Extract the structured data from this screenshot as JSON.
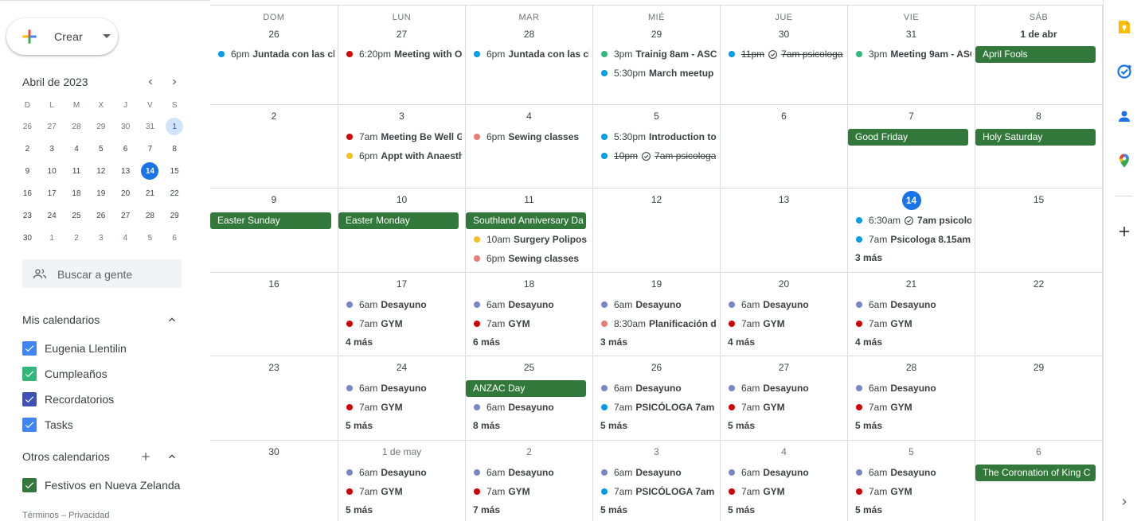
{
  "create": {
    "label": "Crear"
  },
  "mini_calendar": {
    "title": "Abril de 2023",
    "weekdays": [
      "D",
      "L",
      "M",
      "X",
      "J",
      "V",
      "S"
    ],
    "weeks": [
      [
        "26",
        "27",
        "28",
        "29",
        "30",
        "31",
        "1"
      ],
      [
        "2",
        "3",
        "4",
        "5",
        "6",
        "7",
        "8"
      ],
      [
        "9",
        "10",
        "11",
        "12",
        "13",
        "14",
        "15"
      ],
      [
        "16",
        "17",
        "18",
        "19",
        "20",
        "21",
        "22"
      ],
      [
        "23",
        "24",
        "25",
        "26",
        "27",
        "28",
        "29"
      ],
      [
        "30",
        "1",
        "2",
        "3",
        "4",
        "5",
        "6"
      ]
    ]
  },
  "search_people": {
    "placeholder": "Buscar a gente"
  },
  "my_calendars": {
    "title": "Mis calendarios",
    "items": [
      {
        "label": "Eugenia Llentilin",
        "color": "#4285f4"
      },
      {
        "label": "Cumpleaños",
        "color": "#33b679"
      },
      {
        "label": "Recordatorios",
        "color": "#3f51b5"
      },
      {
        "label": "Tasks",
        "color": "#4285f4"
      }
    ]
  },
  "other_calendars": {
    "title": "Otros calendarios",
    "items": [
      {
        "label": "Festivos en Nueva Zelanda",
        "color": "#33783b"
      }
    ]
  },
  "footer": {
    "text": "Términos – Privacidad"
  },
  "colors": {
    "blue": "#039be5",
    "red": "#d50000",
    "green": "#33b679",
    "yellow": "#f6bf26",
    "salmon": "#e67c73",
    "lavender": "#7986cb",
    "holiday": "#33783b",
    "today": "#1a73e8"
  },
  "weekday_headers": [
    "DOM",
    "LUN",
    "MAR",
    "MIÉ",
    "JUE",
    "VIE",
    "SÁB"
  ],
  "weeks": [
    [
      {
        "day": "26",
        "events": [
          {
            "time": "6pm",
            "title": "Juntada con las ch",
            "color": "blue"
          }
        ]
      },
      {
        "day": "27",
        "events": [
          {
            "time": "6:20pm",
            "title": "Meeting with OI",
            "color": "red"
          }
        ]
      },
      {
        "day": "28",
        "events": [
          {
            "time": "6pm",
            "title": "Juntada con las ch",
            "color": "blue"
          }
        ]
      },
      {
        "day": "29",
        "events": [
          {
            "time": "3pm",
            "title": "Trainig 8am - ASC(",
            "color": "green"
          },
          {
            "time": "5:30pm",
            "title": "March meetup I",
            "color": "blue"
          }
        ]
      },
      {
        "day": "30",
        "events": [
          {
            "time": "11pm",
            "title": "7am psicologa",
            "color": "blue",
            "struck": true,
            "task": true
          }
        ]
      },
      {
        "day": "31",
        "events": [
          {
            "time": "3pm",
            "title": "Meeting 9am - ASC",
            "color": "green"
          }
        ]
      },
      {
        "day": "1 de abr",
        "bold": true,
        "allday": [
          "April Fools"
        ],
        "events": []
      }
    ],
    [
      {
        "day": "2",
        "events": []
      },
      {
        "day": "3",
        "events": [
          {
            "time": "7am",
            "title": "Meeting Be Well Gi",
            "color": "red"
          },
          {
            "time": "6pm",
            "title": "Appt with Anaesthe",
            "color": "yellow"
          }
        ]
      },
      {
        "day": "4",
        "events": [
          {
            "time": "6pm",
            "title": "Sewing classes",
            "color": "salmon"
          }
        ]
      },
      {
        "day": "5",
        "events": [
          {
            "time": "5:30pm",
            "title": "Introduction to I",
            "color": "blue"
          },
          {
            "time": "10pm",
            "title": "7am psicologa",
            "color": "blue",
            "struck": true,
            "task": true
          }
        ]
      },
      {
        "day": "6",
        "events": []
      },
      {
        "day": "7",
        "allday": [
          "Good Friday"
        ],
        "events": []
      },
      {
        "day": "8",
        "allday": [
          "Holy Saturday"
        ],
        "events": []
      }
    ],
    [
      {
        "day": "9",
        "allday": [
          "Easter Sunday"
        ],
        "events": []
      },
      {
        "day": "10",
        "allday": [
          "Easter Monday"
        ],
        "events": []
      },
      {
        "day": "11",
        "allday": [
          "Southland Anniversary Da"
        ],
        "events": [
          {
            "time": "10am",
            "title": "Surgery Polipos",
            "color": "yellow"
          },
          {
            "time": "6pm",
            "title": "Sewing classes",
            "color": "salmon"
          }
        ]
      },
      {
        "day": "12",
        "events": []
      },
      {
        "day": "13",
        "events": []
      },
      {
        "day": "14",
        "today": true,
        "events": [
          {
            "time": "6:30am",
            "title": "7am psicolog",
            "color": "blue",
            "task": true
          },
          {
            "time": "7am",
            "title": "Psicologa 8.15am",
            "color": "blue"
          }
        ],
        "more": "3 más"
      },
      {
        "day": "15",
        "events": []
      }
    ],
    [
      {
        "day": "16",
        "events": []
      },
      {
        "day": "17",
        "events": [
          {
            "time": "6am",
            "title": "Desayuno",
            "color": "lavender"
          },
          {
            "time": "7am",
            "title": "GYM",
            "color": "red"
          }
        ],
        "more": "4 más"
      },
      {
        "day": "18",
        "events": [
          {
            "time": "6am",
            "title": "Desayuno",
            "color": "lavender"
          },
          {
            "time": "7am",
            "title": "GYM",
            "color": "red"
          }
        ],
        "more": "6 más"
      },
      {
        "day": "19",
        "events": [
          {
            "time": "6am",
            "title": "Desayuno",
            "color": "lavender"
          },
          {
            "time": "8:30am",
            "title": "Planificación di",
            "color": "salmon"
          }
        ],
        "more": "3 más"
      },
      {
        "day": "20",
        "events": [
          {
            "time": "6am",
            "title": "Desayuno",
            "color": "lavender"
          },
          {
            "time": "7am",
            "title": "GYM",
            "color": "red"
          }
        ],
        "more": "4 más"
      },
      {
        "day": "21",
        "events": [
          {
            "time": "6am",
            "title": "Desayuno",
            "color": "lavender"
          },
          {
            "time": "7am",
            "title": "GYM",
            "color": "red"
          }
        ],
        "more": "4 más"
      },
      {
        "day": "22",
        "events": []
      }
    ],
    [
      {
        "day": "23",
        "events": []
      },
      {
        "day": "24",
        "events": [
          {
            "time": "6am",
            "title": "Desayuno",
            "color": "lavender"
          },
          {
            "time": "7am",
            "title": "GYM",
            "color": "red"
          }
        ],
        "more": "5 más"
      },
      {
        "day": "25",
        "allday": [
          "ANZAC Day"
        ],
        "events": [
          {
            "time": "6am",
            "title": "Desayuno",
            "color": "lavender"
          }
        ],
        "more": "8 más"
      },
      {
        "day": "26",
        "events": [
          {
            "time": "6am",
            "title": "Desayuno",
            "color": "lavender"
          },
          {
            "time": "7am",
            "title": "PSICÓLOGA 7am",
            "color": "blue"
          }
        ],
        "more": "5 más"
      },
      {
        "day": "27",
        "events": [
          {
            "time": "6am",
            "title": "Desayuno",
            "color": "lavender"
          },
          {
            "time": "7am",
            "title": "GYM",
            "color": "red"
          }
        ],
        "more": "5 más"
      },
      {
        "day": "28",
        "events": [
          {
            "time": "6am",
            "title": "Desayuno",
            "color": "lavender"
          },
          {
            "time": "7am",
            "title": "GYM",
            "color": "red"
          }
        ],
        "more": "5 más"
      },
      {
        "day": "29",
        "events": []
      }
    ],
    [
      {
        "day": "30",
        "events": []
      },
      {
        "day": "1 de may",
        "other": true,
        "events": [
          {
            "time": "6am",
            "title": "Desayuno",
            "color": "lavender"
          },
          {
            "time": "7am",
            "title": "GYM",
            "color": "red"
          }
        ],
        "more": "5 más"
      },
      {
        "day": "2",
        "other": true,
        "events": [
          {
            "time": "6am",
            "title": "Desayuno",
            "color": "lavender"
          },
          {
            "time": "7am",
            "title": "GYM",
            "color": "red"
          }
        ],
        "more": "7 más"
      },
      {
        "day": "3",
        "other": true,
        "events": [
          {
            "time": "6am",
            "title": "Desayuno",
            "color": "lavender"
          },
          {
            "time": "7am",
            "title": "PSICÓLOGA 7am",
            "color": "blue"
          }
        ],
        "more": "5 más"
      },
      {
        "day": "4",
        "other": true,
        "events": [
          {
            "time": "6am",
            "title": "Desayuno",
            "color": "lavender"
          },
          {
            "time": "7am",
            "title": "GYM",
            "color": "red"
          }
        ],
        "more": "5 más"
      },
      {
        "day": "5",
        "other": true,
        "events": [
          {
            "time": "6am",
            "title": "Desayuno",
            "color": "lavender"
          },
          {
            "time": "7am",
            "title": "GYM",
            "color": "red"
          }
        ],
        "more": "5 más"
      },
      {
        "day": "6",
        "other": true,
        "allday": [
          "The Coronation of King C"
        ],
        "events": []
      }
    ]
  ],
  "side_panel": {
    "icons": [
      "keep-icon",
      "tasks-icon",
      "contacts-icon",
      "maps-icon",
      "add-icon",
      "expand-icon"
    ]
  }
}
